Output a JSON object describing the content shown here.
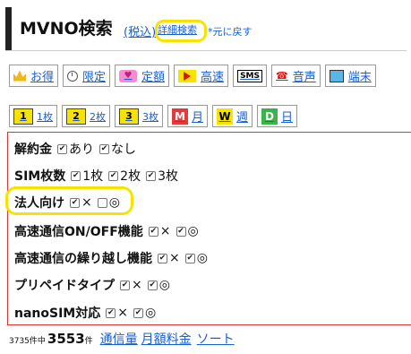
{
  "header": {
    "title": "MVNO検索",
    "tax_link": "(税込)",
    "detail_search": "詳細検索",
    "back": "*元に戻す"
  },
  "categories": [
    {
      "label": "お得",
      "icon": "crown-icon"
    },
    {
      "label": "限定",
      "icon": "clock-icon"
    },
    {
      "label": "定額",
      "icon": "hearts-icon"
    },
    {
      "label": "高速",
      "icon": "arrow-icon"
    },
    {
      "label": "",
      "icon": "sms-icon",
      "icon_text": "SMS"
    },
    {
      "label": "音声",
      "icon": "phone-icon",
      "icon_text": "TEL"
    },
    {
      "label": "端末",
      "icon": "tablet-icon"
    }
  ],
  "quantity": [
    {
      "icon_text": "1",
      "label": "1枚"
    },
    {
      "icon_text": "2",
      "label": "2枚"
    },
    {
      "icon_text": "3",
      "label": "3枚"
    }
  ],
  "period": [
    {
      "icon_text": "M",
      "label": "月"
    },
    {
      "icon_text": "W",
      "label": "週"
    },
    {
      "icon_text": "D",
      "label": "日"
    }
  ],
  "filters": {
    "cancel_fee": {
      "label": "解約金",
      "options": [
        {
          "text": "あり",
          "checked": true
        },
        {
          "text": "なし",
          "checked": true
        }
      ]
    },
    "sim_count": {
      "label": "SIM枚数",
      "options": [
        {
          "text": "1枚",
          "checked": true
        },
        {
          "text": "2枚",
          "checked": true
        },
        {
          "text": "3枚",
          "checked": true
        }
      ]
    },
    "corporate": {
      "label": "法人向け",
      "options": [
        {
          "text": "×",
          "checked": true
        },
        {
          "text": "◎",
          "checked": false
        }
      ]
    },
    "speed_toggle": {
      "label": "高速通信ON/OFF機能",
      "options": [
        {
          "text": "×",
          "checked": true
        },
        {
          "text": "◎",
          "checked": true
        }
      ]
    },
    "carry_over": {
      "label": "高速通信の繰り越し機能",
      "options": [
        {
          "text": "×",
          "checked": true
        },
        {
          "text": "◎",
          "checked": true
        }
      ]
    },
    "prepaid": {
      "label": "プリペイドタイプ",
      "options": [
        {
          "text": "×",
          "checked": true
        },
        {
          "text": "◎",
          "checked": true
        }
      ]
    },
    "nanosim": {
      "label": "nanoSIM対応",
      "options": [
        {
          "text": "×",
          "checked": true
        },
        {
          "text": "◎",
          "checked": true
        }
      ]
    }
  },
  "footer": {
    "total": "3735件中",
    "count": "3553",
    "count_unit": "件",
    "links": [
      "通信量",
      "月額料金",
      "ソート"
    ]
  },
  "colors": {
    "link": "#1a5fd1",
    "highlight": "#f6e400",
    "border": "#d33"
  }
}
